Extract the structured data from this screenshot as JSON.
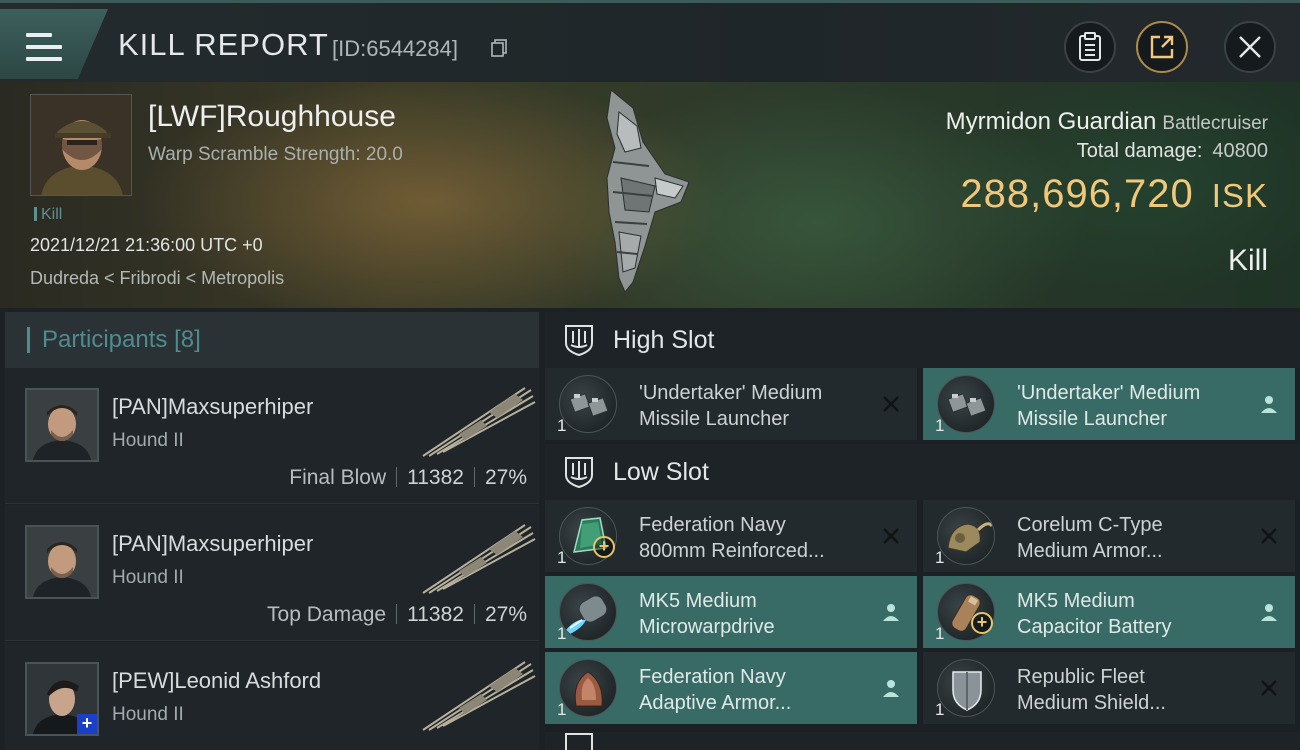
{
  "header": {
    "title": "KILL REPORT",
    "id_label": "[ID:6544284]"
  },
  "victim": {
    "name": "[LWF]Roughhouse",
    "warp_scramble": "Warp Scramble Strength: 20.0",
    "tag": "Kill",
    "time": "2021/12/21 21:36:00 UTC +0",
    "location": "Dudreda < Fribrodi < Metropolis",
    "ship_name": "Myrmidon Guardian",
    "ship_class": "Battlecruiser",
    "total_damage_label": "Total damage:",
    "total_damage_value": "40800",
    "isk_value": "288,696,720",
    "isk_unit": "ISK",
    "result": "Kill"
  },
  "participants": {
    "title": "Participants",
    "count": "[8]",
    "rows": [
      {
        "name": "[PAN]Maxsuperhiper",
        "ship": "Hound II",
        "label": "Final Blow",
        "damage": "11382",
        "percent": "27%"
      },
      {
        "name": "[PAN]Maxsuperhiper",
        "ship": "Hound II",
        "label": "Top Damage",
        "damage": "11382",
        "percent": "27%"
      },
      {
        "name": "[PEW]Leonid Ashford",
        "ship": "Hound II",
        "label": "",
        "damage": "",
        "percent": ""
      }
    ]
  },
  "fittings": {
    "high_slot_title": "High Slot",
    "low_slot_title": "Low Slot",
    "high": [
      {
        "qty": "1",
        "line1": "'Undertaker' Medium",
        "line2": "Missile Launcher",
        "status": "destroyed"
      },
      {
        "qty": "1",
        "line1": "'Undertaker' Medium",
        "line2": "Missile Launcher",
        "status": "dropped"
      }
    ],
    "low": [
      {
        "qty": "1",
        "line1": "Federation Navy",
        "line2": "800mm Reinforced...",
        "status": "destroyed"
      },
      {
        "qty": "1",
        "line1": "Corelum C-Type",
        "line2": "Medium Armor...",
        "status": "destroyed"
      },
      {
        "qty": "1",
        "line1": "MK5 Medium",
        "line2": "Microwarpdrive",
        "status": "dropped"
      },
      {
        "qty": "1",
        "line1": "MK5 Medium",
        "line2": "Capacitor Battery",
        "status": "dropped"
      },
      {
        "qty": "1",
        "line1": "Federation Navy",
        "line2": "Adaptive Armor...",
        "status": "dropped"
      },
      {
        "qty": "1",
        "line1": "Republic Fleet",
        "line2": "Medium Shield...",
        "status": "destroyed"
      }
    ]
  },
  "colors": {
    "accent_teal": "#386a66",
    "isk_gold": "#f0c87a",
    "header_teal": "#4f8b8f"
  }
}
